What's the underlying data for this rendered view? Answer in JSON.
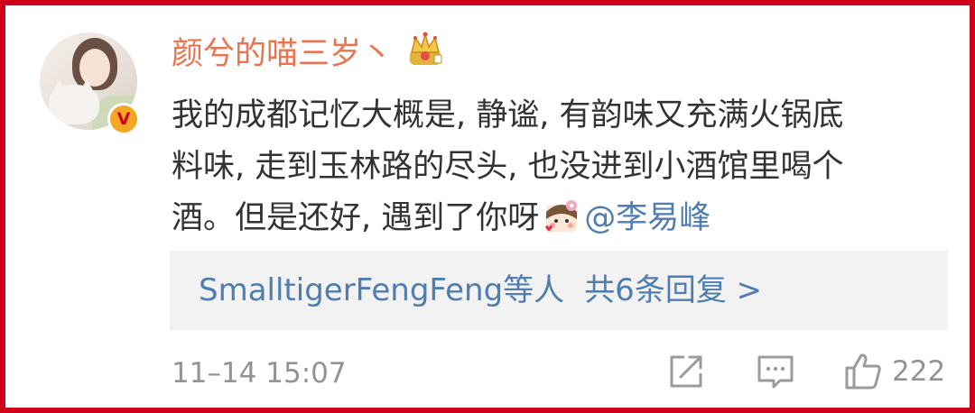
{
  "comment": {
    "username": "颜兮的喵三岁丶",
    "verified_badge": "V",
    "line1": "我的成都记忆大概是, 静谧, 有韵味又充满火锅底",
    "line2": "料味, 走到玉林路的尽头, 也没进到小酒馆里喝个",
    "line3_prefix": "酒。但是还好, 遇到了你呀",
    "mention": "@李易峰",
    "timestamp": "11–14 15:07",
    "like_count": "222"
  },
  "replies": {
    "names": "SmalltigerFengFeng等人",
    "count_label": "共6条回复 >"
  },
  "icons": {
    "avatar": "user-avatar",
    "verified": "verified-v-icon",
    "crown": "crown-member-icon",
    "emoji": "blush-girl-emoji",
    "share": "share-icon",
    "comment": "comment-icon",
    "like": "thumbs-up-icon"
  },
  "colors": {
    "frame": "#d0021b",
    "username": "#eb7350",
    "link": "#507daf",
    "text": "#333333",
    "meta": "#939393",
    "reply_bg": "#f2f2f2"
  }
}
